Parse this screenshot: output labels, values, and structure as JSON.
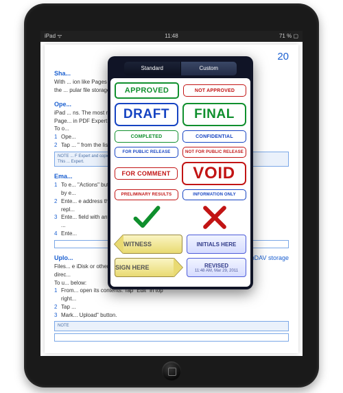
{
  "status": {
    "left": "iPad ᯤ",
    "center": "11:48",
    "right": "71 % ▢"
  },
  "doc": {
    "pagenum": "20",
    "sec1_title": "Sha...",
    "sec1_p1": "With ...                                                            ion like Pages and Numbers, send",
    "sec1_p2": "the ...                                                             pular file storages.",
    "sec2_title": "Ope...",
    "sec2_p1": "iPad ...                                                            ns. The most notable example is",
    "sec2_p2": "Page...                                                             in PDF Expert.",
    "sec2_p3": "To o...",
    "sec2_step1": "Ope...",
    "sec2_step2": "Tap ...                                                          \" from the list.",
    "sec2_note1": "NOTE ...                                                         F Expert and copies it to another application.",
    "sec2_note2": "This ...                                                         Expert.",
    "sec3_title": "Ema...",
    "sec3_step1a": "To e...                                                         \"Actions\" button and then \"Send",
    "sec3_step1b": "by e...",
    "sec3_step2a": "Ente...                                                         e address that your recipient will",
    "sec3_step2b": "repl...",
    "sec3_step3a": "Ente...                                                         field with any contact from your",
    "sec3_step3b": "...",
    "sec3_step4": "Ente...",
    "sec4_title": "Uplo...",
    "sec4_link": "er WebDAV storage",
    "sec4_p1": "Files...                                                            e iDisk or other WebDAV storage",
    "sec4_p2": "direc...",
    "sec4_p3": "To u...                                                             below:",
    "sec4_step1a": "From...                                                         open its contents. Tap \"Edit\" in top",
    "sec4_step1b": "right...",
    "sec4_step2": "Tap ...",
    "sec4_step3": "Mark...                                                          Upload\" button.",
    "sec4_note": "NOTE"
  },
  "popover": {
    "tab_standard": "Standard",
    "tab_custom": "Custom",
    "stamps": {
      "approved": "APPROVED",
      "not_approved": "NOT APPROVED",
      "draft": "DRAFT",
      "final": "FINAL",
      "completed": "COMPLETED",
      "confidential": "CONFIDENTIAL",
      "for_public_release": "FOR PUBLIC RELEASE",
      "not_for_public_release": "NOT FOR PUBLIC RELEASE",
      "for_comment": "FOR COMMENT",
      "void": "VOID",
      "preliminary_results": "PRELIMINARY RESULTS",
      "information_only": "INFORMATION ONLY",
      "witness": "WITNESS",
      "initials_here": "INITIALS HERE",
      "sign_here": "SIGN HERE",
      "revised": "REVISED",
      "revised_sub": "11:48 AM, Mar 29, 2011"
    }
  }
}
